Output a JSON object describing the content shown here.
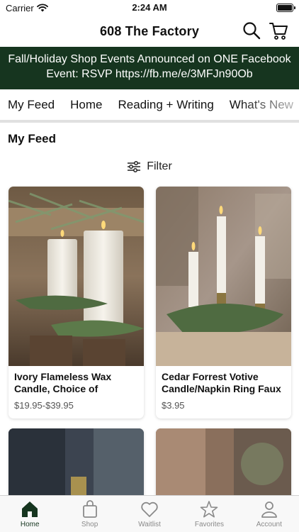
{
  "status": {
    "carrier": "Carrier",
    "time": "2:24 AM"
  },
  "header": {
    "title": "608 The Factory"
  },
  "banner": {
    "line1": "Fall/Holiday Shop Events Announced on ONE Facebook",
    "line2": "Event: RSVP https://fb.me/e/3MFJn90Ob"
  },
  "tabs": [
    {
      "label": "My Feed",
      "active": true
    },
    {
      "label": "Home"
    },
    {
      "label": "Reading + Writing"
    },
    {
      "label": "What's New"
    }
  ],
  "feed": {
    "title": "My Feed",
    "filter_label": "Filter"
  },
  "products": [
    {
      "title": "Ivory Flameless Wax Candle, Choice of",
      "price": "$19.95-$39.95"
    },
    {
      "title": "Cedar Forrest Votive Candle/Napkin Ring Faux",
      "price": "$3.95"
    }
  ],
  "tabbar": [
    {
      "label": "Home",
      "icon": "home-icon",
      "active": true
    },
    {
      "label": "Shop",
      "icon": "shopping-bag-icon"
    },
    {
      "label": "Waitlist",
      "icon": "heart-icon"
    },
    {
      "label": "Favorites",
      "icon": "star-icon"
    },
    {
      "label": "Account",
      "icon": "person-icon"
    }
  ],
  "colors": {
    "brand": "#16351f",
    "inactive": "#8a8a8a"
  }
}
